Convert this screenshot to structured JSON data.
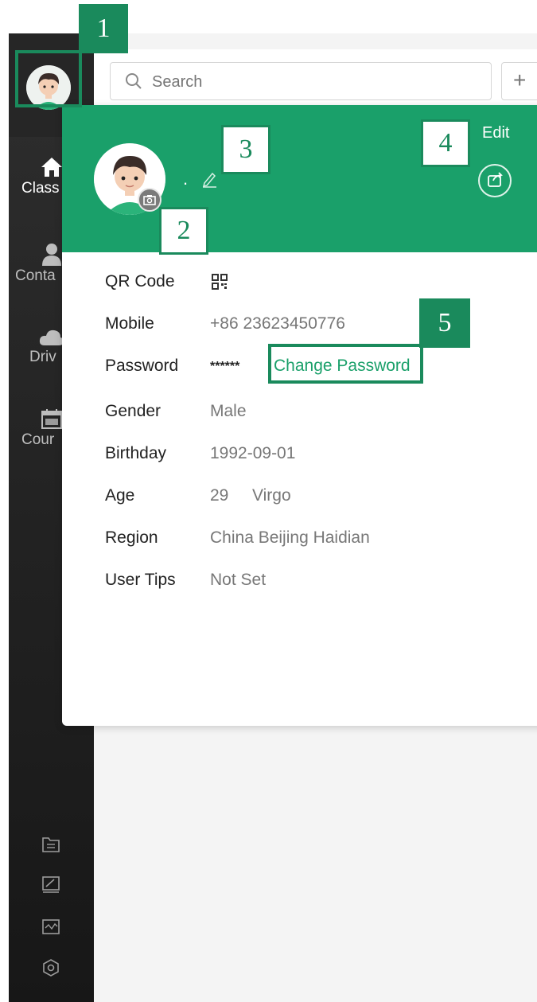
{
  "search": {
    "placeholder": "Search"
  },
  "add_button": {
    "label": "+"
  },
  "sidebar": {
    "items": [
      {
        "label": "Class",
        "icon": "home-icon",
        "active": true
      },
      {
        "label": "Conta",
        "icon": "contacts-icon"
      },
      {
        "label": "Driv",
        "icon": "cloud-icon"
      },
      {
        "label": "Cour",
        "icon": "calendar-icon"
      }
    ],
    "bottom_icons": [
      "folder-transfer-icon",
      "whiteboard-icon",
      "screen-chart-icon",
      "settings-hex-icon"
    ]
  },
  "profile": {
    "name": ".",
    "edit_label": "Edit",
    "fields": [
      {
        "key": "QR Code",
        "value": ""
      },
      {
        "key": "Mobile",
        "value": "+86 23623450776"
      },
      {
        "key": "Password",
        "value": "******",
        "action": "Change Password"
      },
      {
        "key": "Gender",
        "value": "Male"
      },
      {
        "key": "Birthday",
        "value": "1992-09-01"
      },
      {
        "key": "Age",
        "value": "29",
        "extra": "Virgo"
      },
      {
        "key": "Region",
        "value": "China Beijing Haidian"
      },
      {
        "key": "User Tips",
        "value": "Not Set"
      }
    ]
  },
  "callouts": [
    "1",
    "2",
    "3",
    "4",
    "5"
  ],
  "colors": {
    "accent": "#1aa06a",
    "callout": "#1a8a5c",
    "sidebar": "#262626"
  }
}
